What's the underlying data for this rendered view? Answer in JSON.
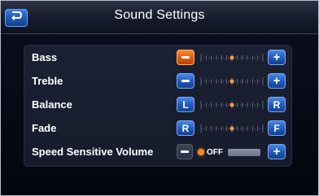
{
  "header": {
    "title": "Sound Settings",
    "back_icon": "back-arrow-icon"
  },
  "colors": {
    "button_blue": "#2159bb",
    "button_active_orange": "#e05a10",
    "indicator_orange": "#ff8a1e",
    "background": "#070a16"
  },
  "settings": [
    {
      "label": "Bass",
      "left_button": "−",
      "right_button": "+",
      "left_state": "active",
      "level": 0.5
    },
    {
      "label": "Treble",
      "left_button": "−",
      "right_button": "+",
      "left_state": "normal",
      "level": 0.5
    },
    {
      "label": "Balance",
      "left_button": "L",
      "right_button": "R",
      "left_state": "normal",
      "level": 0.5
    },
    {
      "label": "Fade",
      "left_button": "R",
      "right_button": "F",
      "left_state": "normal",
      "level": 0.5
    }
  ],
  "speed_sensitive": {
    "label": "Speed Sensitive Volume",
    "left_button": "−",
    "right_button": "+",
    "state_text": "OFF",
    "left_state": "dim"
  }
}
